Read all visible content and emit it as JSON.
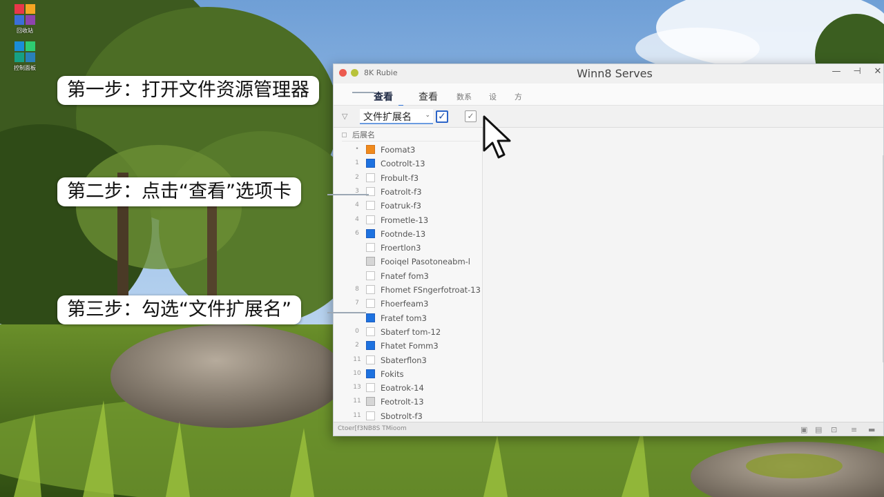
{
  "desktop": {
    "icons": [
      {
        "name": "app-icon-1",
        "caption": "回收站",
        "colors": [
          "#e8374a",
          "#f5a623",
          "#3b6fd8",
          "#8e44ad"
        ]
      },
      {
        "name": "app-icon-2",
        "caption": "控制面板",
        "colors": [
          "#1a8dd8",
          "#2ecc71",
          "#16a085",
          "#2980b9"
        ]
      }
    ]
  },
  "window": {
    "app_label": "8K Rubie",
    "title": "Winn8 Serves",
    "controls": {
      "minimize": "—",
      "maximize": "⊣",
      "close": "✕"
    },
    "ribbon": {
      "tabs": [
        {
          "label": "查看",
          "active": true
        },
        {
          "label": "查看",
          "active": false
        },
        {
          "label": "数系",
          "active": false
        },
        {
          "label": "设",
          "active": false
        },
        {
          "label": "方",
          "active": false
        }
      ]
    },
    "toolbar": {
      "extension_label": "文件扩展名",
      "checked_mark": "✓",
      "grey_mark": "✓"
    },
    "nav": {
      "header": "后展名",
      "items": [
        {
          "num": "•",
          "label": "Foomat3",
          "box": "orange"
        },
        {
          "num": "1",
          "label": "Cootrolt-13",
          "box": "blue"
        },
        {
          "num": "2",
          "label": "Frobult-f3",
          "box": "empty"
        },
        {
          "num": "3",
          "label": "Foatrolt-f3",
          "box": "empty"
        },
        {
          "num": "4",
          "label": "Foatruk-f3",
          "box": "empty"
        },
        {
          "num": "4",
          "label": "Frometle-13",
          "box": "empty"
        },
        {
          "num": "6",
          "label": "Footnde-13",
          "box": "blue"
        },
        {
          "num": "",
          "label": "Froertlon3",
          "box": "empty"
        },
        {
          "num": "",
          "label": "Fooiqel Pasotoneabm-l",
          "box": "grey"
        },
        {
          "num": "",
          "label": "Fnatef fom3",
          "box": "empty"
        },
        {
          "num": "8",
          "label": "Fhomet FSngerfotroat-13",
          "box": "empty"
        },
        {
          "num": "7",
          "label": "Fhoerfeam3",
          "box": "empty"
        },
        {
          "num": "",
          "label": "Fratef tom3",
          "box": "blue"
        },
        {
          "num": "0",
          "label": "Sbaterf tom-12",
          "box": "empty"
        },
        {
          "num": "2",
          "label": "Fhatet Fomm3",
          "box": "blue"
        },
        {
          "num": "11",
          "label": "Sbaterflon3",
          "box": "empty"
        },
        {
          "num": "10",
          "label": "Fokits",
          "box": "blue"
        },
        {
          "num": "13",
          "label": "Eoatrok-14",
          "box": "empty"
        },
        {
          "num": "11",
          "label": "Feotrolt-13",
          "box": "grey"
        },
        {
          "num": "11",
          "label": "Sbotrolt-f3",
          "box": "empty"
        }
      ]
    },
    "status": {
      "text": "Ctoer[f3NB8S   TMioom",
      "icons": [
        "▣",
        "▤",
        "⊡",
        "≡",
        "▬"
      ]
    }
  },
  "callouts": [
    {
      "name": "step-1-callout",
      "text": "第一步：打开文件资源管理器"
    },
    {
      "name": "step-2-callout",
      "text": "第二步：点击“查看”选项卡"
    },
    {
      "name": "step-3-callout",
      "text": "第三步：勾选“文件扩展名”"
    }
  ],
  "colors": {
    "accent_blue": "#1d72e0",
    "checkbox_orange": "#f08a1c",
    "close_red": "#ec5a4f"
  }
}
